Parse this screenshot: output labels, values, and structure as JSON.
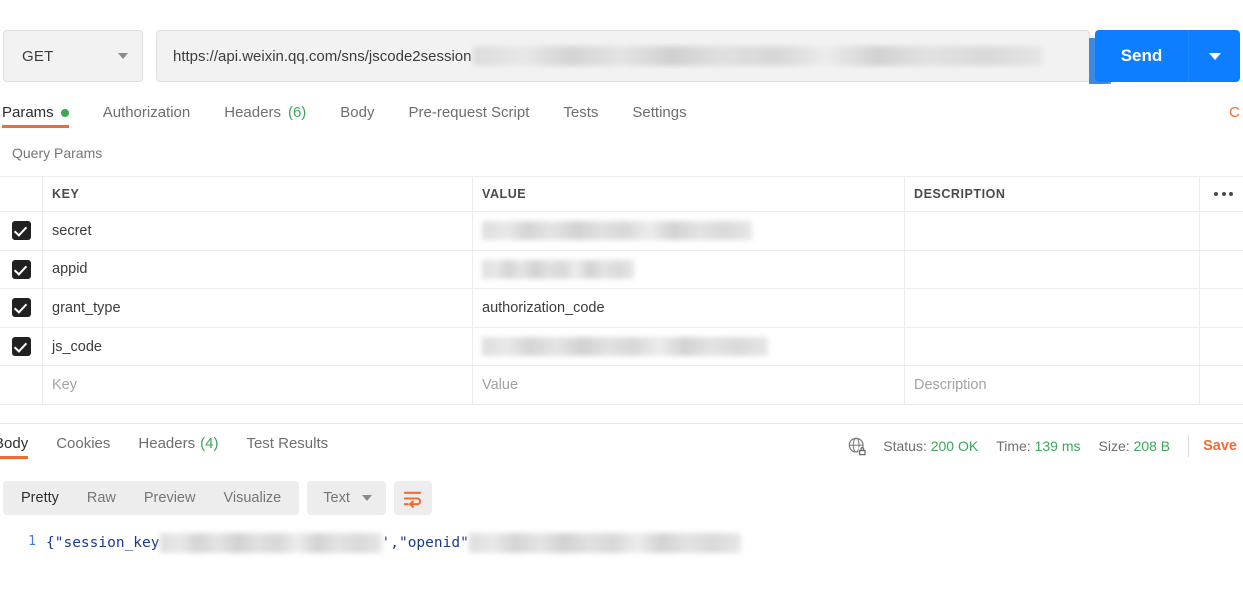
{
  "request": {
    "method": "GET",
    "method_caret_icon": "chevron-down-icon",
    "url": "https://api.weixin.qq.com/sns/jscode2session",
    "url_redacted_suffix": "",
    "send_label": "Send",
    "send_caret_icon": "chevron-down-icon"
  },
  "request_tabs": [
    {
      "label": "Params",
      "badge": "",
      "has_dot": true,
      "active": true
    },
    {
      "label": "Authorization",
      "badge": "",
      "has_dot": false,
      "active": false
    },
    {
      "label": "Headers",
      "badge": "(6)",
      "has_dot": false,
      "active": false
    },
    {
      "label": "Body",
      "badge": "",
      "has_dot": false,
      "active": false
    },
    {
      "label": "Pre-request Script",
      "badge": "",
      "has_dot": false,
      "active": false
    },
    {
      "label": "Tests",
      "badge": "",
      "has_dot": false,
      "active": false
    },
    {
      "label": "Settings",
      "badge": "",
      "has_dot": false,
      "active": false
    }
  ],
  "cookies_edge_label": "C",
  "query_params": {
    "section_label": "Query Params",
    "columns": [
      "KEY",
      "VALUE",
      "DESCRIPTION"
    ],
    "bulk_edit_icon": "ellipsis-icon",
    "rows": [
      {
        "checked": true,
        "key": "secret",
        "value": "",
        "value_redacted": true,
        "value_redact_width": 270,
        "description": ""
      },
      {
        "checked": true,
        "key": "appid",
        "value": "",
        "value_redacted": true,
        "value_redact_width": 152,
        "description": ""
      },
      {
        "checked": true,
        "key": "grant_type",
        "value": "authorization_code",
        "value_redacted": false,
        "value_redact_width": 0,
        "description": ""
      },
      {
        "checked": true,
        "key": "js_code",
        "value": "",
        "value_redacted": true,
        "value_redact_width": 286,
        "description": ""
      }
    ],
    "placeholder_row": {
      "key_placeholder": "Key",
      "value_placeholder": "Value",
      "description_placeholder": "Description"
    }
  },
  "response_tabs": [
    {
      "label": "Body",
      "badge": "",
      "active": true
    },
    {
      "label": "Cookies",
      "badge": "",
      "active": false
    },
    {
      "label": "Headers",
      "badge": "(4)",
      "active": false
    },
    {
      "label": "Test Results",
      "badge": "",
      "active": false
    }
  ],
  "response_status": {
    "network_icon": "globe-lock-icon",
    "status_label": "Status:",
    "status_value": "200 OK",
    "time_label": "Time:",
    "time_value": "139 ms",
    "size_label": "Size:",
    "size_value": "208 B",
    "save_label": "Save"
  },
  "format_bar": {
    "views": [
      {
        "label": "Pretty",
        "active": true
      },
      {
        "label": "Raw",
        "active": false
      },
      {
        "label": "Preview",
        "active": false
      },
      {
        "label": "Visualize",
        "active": false
      }
    ],
    "type_selected": "Text",
    "type_caret_icon": "chevron-down-icon",
    "wrap_icon": "word-wrap-icon"
  },
  "response_body": {
    "line_number": "1",
    "segment_1": "{\"session_key",
    "segment_2": "',\"openid\"",
    "redact_1_width": 222,
    "redact_2_width": 272
  },
  "colors": {
    "accent_orange": "#ef6c34",
    "send_blue": "#0d7eff",
    "success_green": "#3aa757",
    "checkbox_dark": "#212121",
    "text_primary": "#3c3c3c",
    "text_muted": "#6e6e6e"
  }
}
